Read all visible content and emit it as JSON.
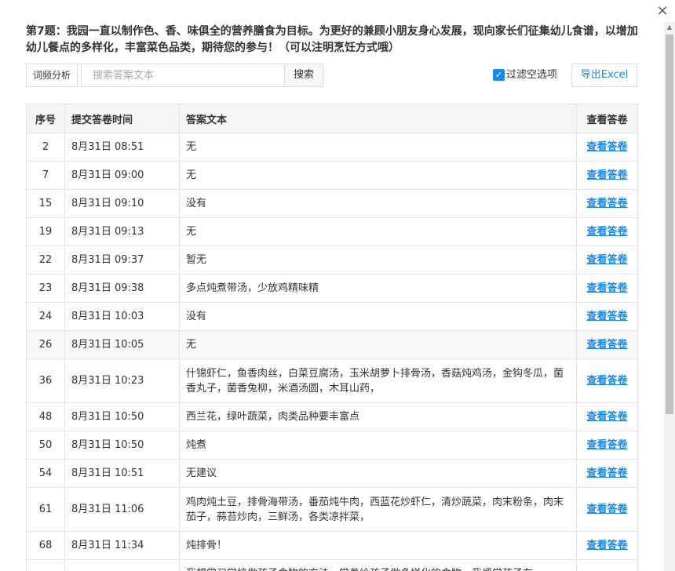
{
  "dialog": {
    "question": "第7题：我园一直以制作色、香、味俱全的营养膳食为目标。为更好的兼顾小朋友身心发展，现向家长们征集幼儿食谱，以增加幼儿餐点的多样化，丰富菜色品类，期待您的参与！（可以注明烹饪方式哦）",
    "close_glyph": "×"
  },
  "toolbar": {
    "word_freq_label": "词频分析",
    "search_placeholder": "搜索答案文本",
    "search_label": "搜索",
    "filter_label": "过滤空选项",
    "filter_checked": true,
    "export_label": "导出Excel"
  },
  "table": {
    "headers": [
      "序号",
      "提交答卷时间",
      "答案文本",
      "查看答卷"
    ],
    "rows": [
      {
        "idx": "2",
        "time": "8月31日 08:51",
        "text": "无",
        "link": "查看答卷"
      },
      {
        "idx": "7",
        "time": "8月31日 09:00",
        "text": "无",
        "link": "查看答卷"
      },
      {
        "idx": "15",
        "time": "8月31日 09:10",
        "text": "没有",
        "link": "查看答卷"
      },
      {
        "idx": "19",
        "time": "8月31日 09:13",
        "text": "无",
        "link": "查看答卷"
      },
      {
        "idx": "22",
        "time": "8月31日 09:37",
        "text": "暂无",
        "link": "查看答卷"
      },
      {
        "idx": "23",
        "time": "8月31日 09:38",
        "text": "多点炖煮带汤，少放鸡精味精",
        "link": "查看答卷"
      },
      {
        "idx": "24",
        "time": "8月31日 10:03",
        "text": "没有",
        "link": "查看答卷"
      },
      {
        "idx": "26",
        "time": "8月31日 10:05",
        "text": "无",
        "link": "查看答卷"
      },
      {
        "idx": "36",
        "time": "8月31日 10:23",
        "text": "什锦虾仁，鱼香肉丝，白菜豆腐汤，玉米胡萝卜排骨汤，香菇炖鸡汤，金钩冬瓜，菌香丸子，菌香兔柳，米酒汤圆，木耳山药，",
        "link": "查看答卷"
      },
      {
        "idx": "48",
        "time": "8月31日 10:50",
        "text": "西兰花，绿叶蔬菜，肉类品种要丰富点",
        "link": "查看答卷"
      },
      {
        "idx": "50",
        "time": "8月31日 10:50",
        "text": "炖煮",
        "link": "查看答卷"
      },
      {
        "idx": "54",
        "time": "8月31日 10:51",
        "text": "无建议",
        "link": "查看答卷"
      },
      {
        "idx": "61",
        "time": "8月31日 11:06",
        "text": "鸡肉炖土豆，排骨海带汤，番茄炖牛肉，西蓝花炒虾仁，清炒蔬菜，肉末粉条，肉末茄子，蒜苔炒肉，三鲜汤，各类凉拌菜，",
        "link": "查看答卷"
      },
      {
        "idx": "68",
        "time": "8月31日 11:34",
        "text": "炖排骨！",
        "link": "查看答卷"
      },
      {
        "idx": "",
        "time": "",
        "text": "我想学习学校做孩子食物的方法，觉着给孩子做多样化的食物，我感觉孩子在",
        "link": ""
      }
    ]
  },
  "colors": {
    "accent": "#1e88e5",
    "header_bg": "#f5f5f5",
    "border": "#e3e3e3"
  }
}
